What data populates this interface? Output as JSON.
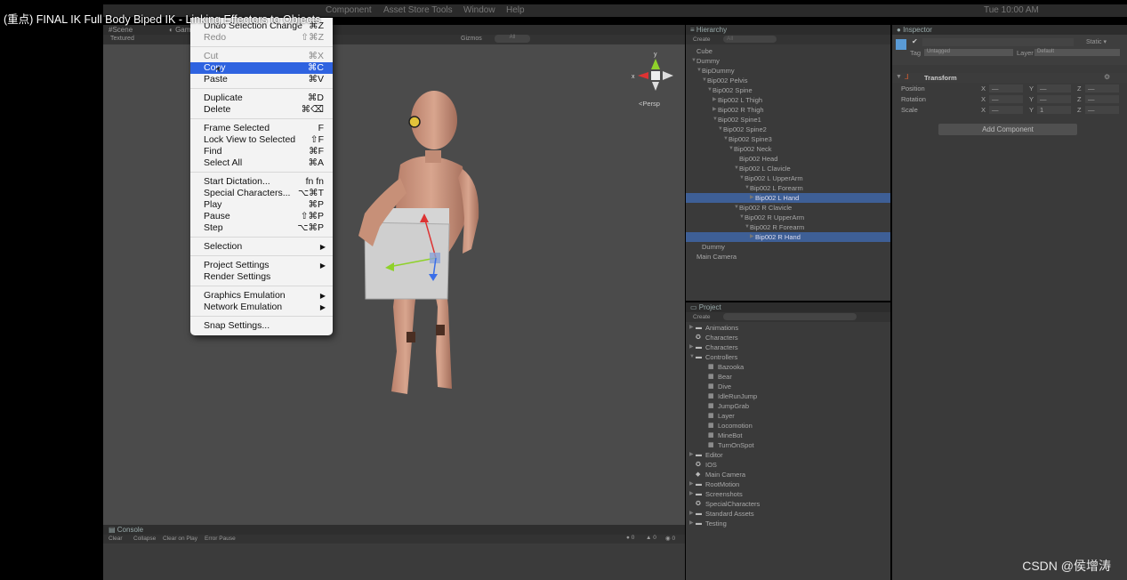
{
  "video_title": "(重点) FINAL IK Full Body Biped IK - Linking Effectors to Objects",
  "menubar": {
    "items": [
      "Component",
      "Asset Store Tools",
      "Window",
      "Help"
    ],
    "right_text": "Tue 10:00 AM"
  },
  "scene": {
    "tabs": [
      "Scene",
      "Game"
    ],
    "shading_mode": "Textured",
    "gizmos_label": "Gizmos",
    "search_placeholder": "All",
    "persp_label": "Persp",
    "gizmo_axes": {
      "x": "x",
      "y": "y"
    }
  },
  "edit_menu": {
    "groups": [
      [
        {
          "label": "Undo Selection Change",
          "shortcut": "⌘Z"
        },
        {
          "label": "Redo",
          "shortcut": "⇧⌘Z",
          "disabled": true
        }
      ],
      [
        {
          "label": "Cut",
          "shortcut": "⌘X",
          "disabled": true
        },
        {
          "label": "Copy",
          "shortcut": "⌘C",
          "highlighted": true
        },
        {
          "label": "Paste",
          "shortcut": "⌘V"
        }
      ],
      [
        {
          "label": "Duplicate",
          "shortcut": "⌘D"
        },
        {
          "label": "Delete",
          "shortcut": "⌘⌫"
        }
      ],
      [
        {
          "label": "Frame Selected",
          "shortcut": "F"
        },
        {
          "label": "Lock View to Selected",
          "shortcut": "⇧F"
        },
        {
          "label": "Find",
          "shortcut": "⌘F"
        },
        {
          "label": "Select All",
          "shortcut": "⌘A"
        }
      ],
      [
        {
          "label": "Start Dictation...",
          "shortcut": "fn fn"
        },
        {
          "label": "Special Characters...",
          "shortcut": "⌥⌘T"
        },
        {
          "label": "Play",
          "shortcut": "⌘P"
        },
        {
          "label": "Pause",
          "shortcut": "⇧⌘P"
        },
        {
          "label": "Step",
          "shortcut": "⌥⌘P"
        }
      ],
      [
        {
          "label": "Selection",
          "submenu": true
        }
      ],
      [
        {
          "label": "Project Settings",
          "submenu": true
        },
        {
          "label": "Render Settings"
        }
      ],
      [
        {
          "label": "Graphics Emulation",
          "submenu": true
        },
        {
          "label": "Network Emulation",
          "submenu": true
        }
      ],
      [
        {
          "label": "Snap Settings..."
        }
      ]
    ]
  },
  "hierarchy": {
    "title": "Hierarchy",
    "create_label": "Create",
    "search_placeholder": "All",
    "items": [
      {
        "label": "Cube",
        "depth": 0,
        "arrow": ""
      },
      {
        "label": "Dummy",
        "depth": 0,
        "arrow": "▼"
      },
      {
        "label": "BipDummy",
        "depth": 1,
        "arrow": "▼"
      },
      {
        "label": "Bip002 Pelvis",
        "depth": 2,
        "arrow": "▼"
      },
      {
        "label": "Bip002 Spine",
        "depth": 3,
        "arrow": "▼"
      },
      {
        "label": "Bip002 L Thigh",
        "depth": 4,
        "arrow": "▶"
      },
      {
        "label": "Bip002 R Thigh",
        "depth": 4,
        "arrow": "▶"
      },
      {
        "label": "Bip002 Spine1",
        "depth": 4,
        "arrow": "▼"
      },
      {
        "label": "Bip002 Spine2",
        "depth": 5,
        "arrow": "▼"
      },
      {
        "label": "Bip002 Spine3",
        "depth": 6,
        "arrow": "▼"
      },
      {
        "label": "Bip002 Neck",
        "depth": 7,
        "arrow": "▼"
      },
      {
        "label": "Bip002 Head",
        "depth": 8,
        "arrow": ""
      },
      {
        "label": "Bip002 L Clavicle",
        "depth": 8,
        "arrow": "▼"
      },
      {
        "label": "Bip002 L UpperArm",
        "depth": 9,
        "arrow": "▼"
      },
      {
        "label": "Bip002 L Forearm",
        "depth": 10,
        "arrow": "▼"
      },
      {
        "label": "Bip002 L Hand",
        "depth": 11,
        "arrow": "▶",
        "selected": true
      },
      {
        "label": "Bip002 R Clavicle",
        "depth": 8,
        "arrow": "▼"
      },
      {
        "label": "Bip002 R UpperArm",
        "depth": 9,
        "arrow": "▼"
      },
      {
        "label": "Bip002 R Forearm",
        "depth": 10,
        "arrow": "▼"
      },
      {
        "label": "Bip002 R Hand",
        "depth": 11,
        "arrow": "▶",
        "selected": true
      },
      {
        "label": "Dummy",
        "depth": 1,
        "arrow": ""
      },
      {
        "label": "Main Camera",
        "depth": 0,
        "arrow": ""
      }
    ]
  },
  "project": {
    "title": "Project",
    "create_label": "Create",
    "items": [
      {
        "label": "Animations",
        "depth": 0,
        "kind": "folder",
        "arrow": "▶"
      },
      {
        "label": "Characters",
        "depth": 0,
        "kind": "scene",
        "arrow": ""
      },
      {
        "label": "Characters",
        "depth": 0,
        "kind": "folder",
        "arrow": "▶"
      },
      {
        "label": "Controllers",
        "depth": 0,
        "kind": "folder",
        "arrow": "▼"
      },
      {
        "label": "Bazooka",
        "depth": 1,
        "kind": "asset",
        "arrow": ""
      },
      {
        "label": "Bear",
        "depth": 1,
        "kind": "asset",
        "arrow": ""
      },
      {
        "label": "Dive",
        "depth": 1,
        "kind": "asset",
        "arrow": ""
      },
      {
        "label": "IdleRunJump",
        "depth": 1,
        "kind": "asset",
        "arrow": ""
      },
      {
        "label": "JumpGrab",
        "depth": 1,
        "kind": "asset",
        "arrow": ""
      },
      {
        "label": "Layer",
        "depth": 1,
        "kind": "asset",
        "arrow": ""
      },
      {
        "label": "Locomotion",
        "depth": 1,
        "kind": "asset",
        "arrow": ""
      },
      {
        "label": "MineBot",
        "depth": 1,
        "kind": "asset",
        "arrow": ""
      },
      {
        "label": "TurnOnSpot",
        "depth": 1,
        "kind": "asset",
        "arrow": ""
      },
      {
        "label": "Editor",
        "depth": 0,
        "kind": "folder",
        "arrow": "▶"
      },
      {
        "label": "IOS",
        "depth": 0,
        "kind": "scene",
        "arrow": ""
      },
      {
        "label": "Main Camera",
        "depth": 0,
        "kind": "prefab",
        "arrow": ""
      },
      {
        "label": "RootMotion",
        "depth": 0,
        "kind": "folder",
        "arrow": "▶"
      },
      {
        "label": "Screenshots",
        "depth": 0,
        "kind": "folder",
        "arrow": "▶"
      },
      {
        "label": "SpecialCharacters",
        "depth": 0,
        "kind": "scene",
        "arrow": ""
      },
      {
        "label": "Standard Assets",
        "depth": 0,
        "kind": "folder",
        "arrow": "▶"
      },
      {
        "label": "Testing",
        "depth": 0,
        "kind": "folder",
        "arrow": "▶"
      }
    ]
  },
  "inspector": {
    "title": "Inspector",
    "static_label": "Static",
    "tag_label": "Tag",
    "tag_value": "Untagged",
    "layer_label": "Layer",
    "layer_value": "Default",
    "transform_title": "Transform",
    "fields": [
      {
        "label": "Position",
        "x": "—",
        "y": "—",
        "z": "—"
      },
      {
        "label": "Rotation",
        "x": "—",
        "y": "—",
        "z": "—"
      },
      {
        "label": "Scale",
        "x": "—",
        "y": "1",
        "z": "—"
      }
    ],
    "axis_x": "X",
    "axis_y": "Y",
    "axis_z": "Z",
    "add_component": "Add Component"
  },
  "console": {
    "title": "Console",
    "buttons": [
      "Clear",
      "Collapse",
      "Clear on Play",
      "Error Pause"
    ],
    "counts": {
      "info": "0",
      "warn": "0",
      "error": "0"
    }
  },
  "watermark": "CSDN @侯增涛",
  "colors": {
    "menu_highlight": "#2f63e0",
    "selection": "#3e5f96",
    "panel_bg": "#3a3a3a",
    "scene_bg": "#4b4b4b"
  }
}
